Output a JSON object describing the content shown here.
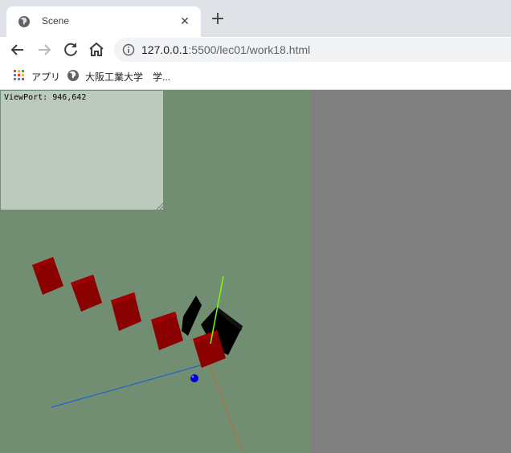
{
  "tab": {
    "title": "Scene",
    "favicon": "globe-icon",
    "close_glyph": "✕"
  },
  "new_tab_glyph": "+",
  "toolbar": {
    "back_icon": "back-arrow-icon",
    "forward_icon": "forward-arrow-icon",
    "reload_icon": "reload-icon",
    "home_icon": "home-icon",
    "info_icon": "info-icon",
    "url_host": "127.0.0.1",
    "url_rest": ":5500/lec01/work18.html"
  },
  "bookmarks": [
    {
      "label": "アプリ",
      "icon": "apps-grid-icon"
    },
    {
      "label": "大阪工業大学",
      "icon": "globe-icon"
    },
    {
      "label": "学...",
      "icon": ""
    }
  ],
  "scene": {
    "viewport_label": "ViewPort: 946,642",
    "background_color": "#728e72",
    "page_color": "#808080",
    "overlay_color": "#bccabd",
    "cube_color": "#8b0000",
    "shadow_color": "#000000",
    "sphere_color": "#0000cc",
    "axis_colors": {
      "x": "#1c64c8",
      "y": "#7cfc00",
      "z": "#b07040"
    }
  }
}
